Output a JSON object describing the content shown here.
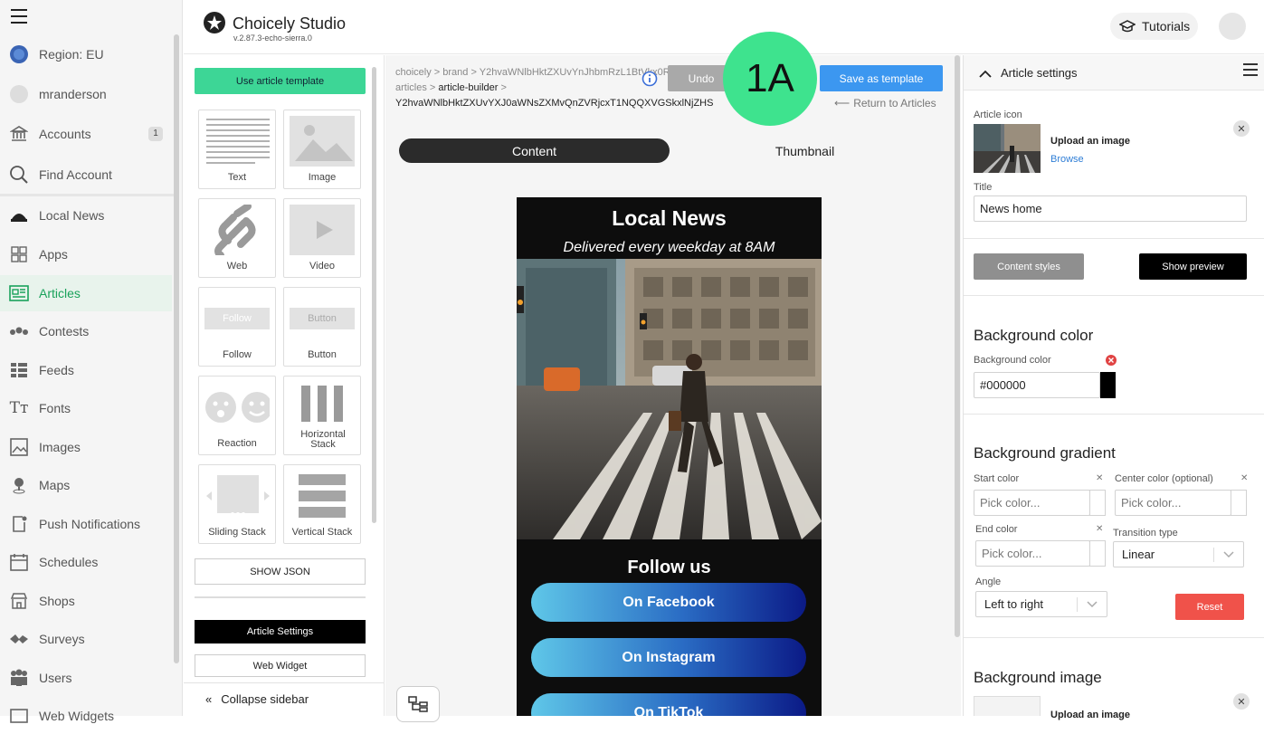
{
  "nav": {
    "items": [
      {
        "label": "Region: EU",
        "icon": "globe-icon"
      },
      {
        "label": "mranderson",
        "icon": "avatar-icon"
      },
      {
        "label": "Accounts",
        "icon": "bank-icon",
        "badge": "1"
      },
      {
        "label": "Find Account",
        "icon": "search-icon"
      },
      {
        "label": "Local News",
        "icon": "cloche-icon"
      },
      {
        "label": "Apps",
        "icon": "grid-icon"
      },
      {
        "label": "Articles",
        "icon": "article-icon",
        "active": true
      },
      {
        "label": "Contests",
        "icon": "contests-icon"
      },
      {
        "label": "Feeds",
        "icon": "feed-icon"
      },
      {
        "label": "Fonts",
        "icon": "font-icon"
      },
      {
        "label": "Images",
        "icon": "image-icon"
      },
      {
        "label": "Maps",
        "icon": "map-pin-icon"
      },
      {
        "label": "Push Notifications",
        "icon": "push-icon"
      },
      {
        "label": "Schedules",
        "icon": "calendar-icon"
      },
      {
        "label": "Shops",
        "icon": "shop-icon"
      },
      {
        "label": "Surveys",
        "icon": "survey-icon"
      },
      {
        "label": "Users",
        "icon": "users-icon"
      },
      {
        "label": "Web Widgets",
        "icon": "widget-icon"
      }
    ]
  },
  "header": {
    "app_name": "Choicely Studio",
    "version": "v.2.87.3-echo-sierra.0",
    "tutorials_label": "Tutorials"
  },
  "widgets": {
    "template_button": "Use article template",
    "tiles": [
      "Text",
      "Image",
      "Web",
      "Video",
      "Follow",
      "Button",
      "Reaction",
      "Horizontal Stack",
      "Sliding Stack",
      "Vertical Stack"
    ],
    "follow_preview": "Follow",
    "button_preview": "Button",
    "show_json": "SHOW JSON",
    "article_settings": "Article Settings",
    "web_widget": "Web Widget",
    "collapse": "Collapse sidebar"
  },
  "center": {
    "breadcrumb_line1": "choicely > brand > Y2hvaWNlbHktZXUvYnJhbmRzL1BtVkx0R0lnakrjvd",
    "breadcrumb_line2_prefix": "articles >",
    "breadcrumb_line2_current": "article-builder",
    "breadcrumb_line2_suffix": ">",
    "breadcrumb_line3": "Y2hvaWNlbHktZXUvYXJ0aWNsZXMvQnZVRjcxT1NQQXVGSkxlNjZHS",
    "undo": "Undo",
    "save_template": "Save as template",
    "return": "Return to Articles",
    "step_badge": "1A",
    "tab_content": "Content",
    "tab_thumbnail": "Thumbnail"
  },
  "phone": {
    "title": "Local News",
    "subtitle": "Delivered every weekday at 8AM",
    "follow_heading": "Follow us",
    "buttons": [
      "On Facebook",
      "On Instagram",
      "On TikTok"
    ]
  },
  "settings": {
    "header": "Article settings",
    "article_icon_label": "Article icon",
    "upload_image": "Upload an image",
    "browse": "Browse",
    "title_label": "Title",
    "title_value": "News home",
    "content_styles": "Content styles",
    "show_preview": "Show preview",
    "bg_color_heading": "Background color",
    "bg_color_label": "Background color",
    "bg_color_value": "#000000",
    "bg_gradient_heading": "Background gradient",
    "start_color": "Start color",
    "center_color": "Center color (optional)",
    "end_color": "End color",
    "transition_type": "Transition type",
    "pick_color": "Pick color...",
    "transition_value": "Linear",
    "angle_label": "Angle",
    "angle_value": "Left to right",
    "reset": "Reset",
    "bg_image_heading": "Background image",
    "upload_image_2": "Upload an image"
  },
  "colors": {
    "accent_green": "#3dd696",
    "badge_green": "#3ee38e",
    "primary_blue": "#3c97f0",
    "reset_red": "#f0524a"
  }
}
